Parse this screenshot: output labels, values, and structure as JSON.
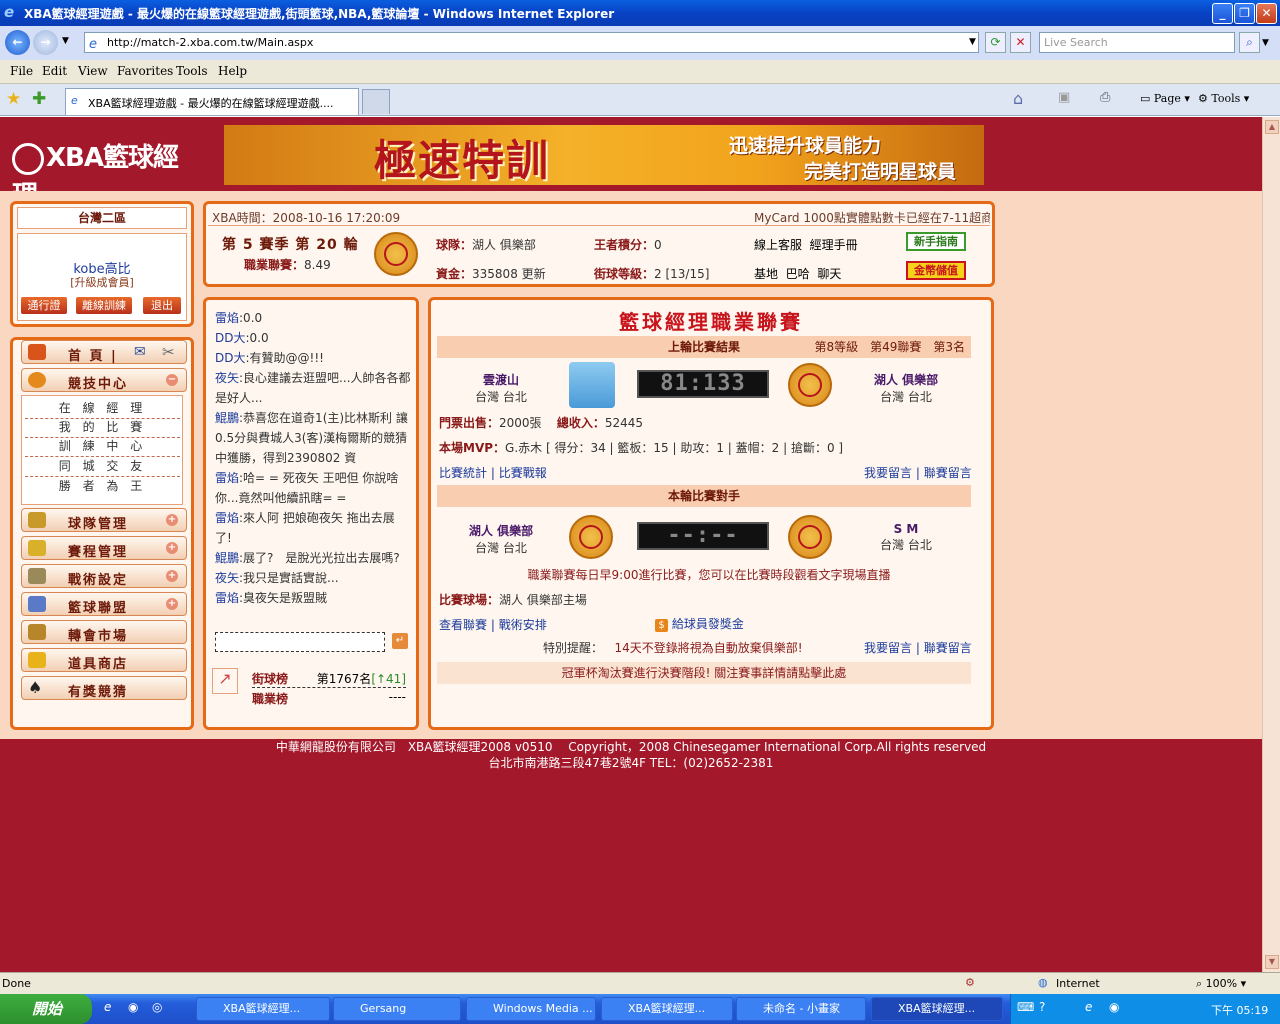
{
  "window": {
    "title": "XBA籃球經理遊戲 - 最火爆的在線籃球經理遊戲,街頭籃球,NBA,籃球論壇 - Windows Internet Explorer",
    "url": "http://match-2.xba.com.tw/Main.aspx",
    "search_placeholder": "Live Search",
    "menu": [
      "File",
      "Edit",
      "View",
      "Favorites",
      "Tools",
      "Help"
    ],
    "tab_title": "XBA籃球經理遊戲 - 最火爆的在線籃球經理遊戲....",
    "toolbar": {
      "page": "Page",
      "tools": "Tools"
    }
  },
  "header": {
    "logo": "XBA籃球經理",
    "banner_title": "極速特訓",
    "banner_line1": "迅速提升球員能力",
    "banner_line2": "完美打造明星球員"
  },
  "user": {
    "region": "台灣二區",
    "name": "kobe高比",
    "upgrade": "[升級成會員]",
    "buttons": [
      "通行證",
      "離線訓練",
      "退出"
    ]
  },
  "info": {
    "time_label": "XBA時間：",
    "time": "2008-10-16 17:20:09",
    "marquee": "MyCard 1000點實體點數卡已經在7-11超商",
    "season": "第 5 賽季 第 20 輪",
    "league_label": "職業聯賽：",
    "league_val": "8.49",
    "team_label": "球隊：",
    "team": "湖人 俱樂部",
    "king_label": "王者積分：",
    "king": "0",
    "service": "線上客服",
    "manual": "經理手冊",
    "newbie": "新手指南",
    "money_label": "資金：",
    "money": "335808",
    "update": "更新",
    "street_label": "街球等級：",
    "street": "2 [13/15]",
    "base": "基地",
    "bah": "巴哈",
    "chat": "聊天",
    "deposit": "金幣儲值"
  },
  "nav": {
    "home": "首 頁 |",
    "compete": "競技中心",
    "sub": [
      "在 線 經 理",
      "我 的 比 賽",
      "訓 練 中 心",
      "同 城 交 友",
      "勝 者 為 王"
    ],
    "items": [
      "球隊管理",
      "賽程管理",
      "戰術設定",
      "籃球聯盟",
      "轉會市場",
      "道具商店",
      "有獎競猜"
    ]
  },
  "chat": [
    {
      "n": "雷焰",
      "t": ":0.0"
    },
    {
      "n": "DD大",
      "t": ":0.0"
    },
    {
      "n": "DD大",
      "t": ":有贊助@@!!!"
    },
    {
      "n": "夜矢",
      "t": ":良心建議去逛盟吧...人帥各各都是好人..."
    },
    {
      "n": "鯤鵬",
      "t": ":恭喜您在道奇1(主)比林斯利 讓0.5分與費城人3(客)漢梅爾斯的競猜中獲勝，得到2390802 資"
    },
    {
      "n": "雷焰",
      "t": ":哈= = 死夜矢 王吧但 你說啥你...竟然叫他續訊瞎= ="
    },
    {
      "n": "雷焰",
      "t": ":來人阿 把娘砲夜矢 拖出去展了!"
    },
    {
      "n": "鯤鵬",
      "t": ":展了?　是脫光光拉出去展嗎?"
    },
    {
      "n": "夜矢",
      "t": ":我只是實話實說..."
    },
    {
      "n": "雷焰",
      "t": ":臭夜矢是叛盟賊"
    }
  ],
  "ranks": {
    "street_label": "街球榜",
    "street_val": "第1767名",
    "street_delta": "[↑41]",
    "pro_label": "職業榜",
    "pro_val": "----"
  },
  "league": {
    "title": "籃球經理職業聯賽",
    "last_header": "上輪比賽結果",
    "level_info": "第8等級　第49聯賽　第3名",
    "home_team": "雲渡山",
    "home_loc": "台灣 台北",
    "away_team": "湖人 俱樂部",
    "away_loc": "台灣 台北",
    "score": "81:133",
    "ticket_label": "門票出售：",
    "ticket": "2000張",
    "income_label": "總收入：",
    "income": "52445",
    "mvp_label": "本場MVP：",
    "mvp": "G.赤木 [ 得分：34 | 籃板：15 | 助攻：1 | 蓋帽：2 | 搶斷：0 ]",
    "stats_link": "比賽統計",
    "report_link": "比賽戰報",
    "msg_link": "我要留言",
    "league_msg_link": "聯賽留言",
    "next_header": "本輪比賽對手",
    "next_home": "湖人 俱樂部",
    "next_home_loc": "台灣 台北",
    "next_away": "S M",
    "next_away_loc": "台灣 台北",
    "next_score": "--:--",
    "schedule_note": "職業聯賽每日早9:00進行比賽，您可以在比賽時段觀看文字現場直播",
    "arena_label": "比賽球場：",
    "arena": "湖人 俱樂部主場",
    "view_league": "查看聯賽",
    "tactics": "戰術安排",
    "bonus": "給球員發獎金",
    "warn_label": "特別提醒：",
    "warn": "14天不登錄將視為自動放棄俱樂部!",
    "cup_note": "冠軍杯淘汰賽進行決賽階段! 關注賽事詳情請點擊此處"
  },
  "footer": {
    "line1": "中華網龍股份有限公司　XBA籃球經理2008 v0510　 Copyright，2008 Chinesegamer International Corp.All rights reserved",
    "line2": "台北市南港路三段47巷2號4F TEL：(02)2652-2381"
  },
  "status": {
    "done": "Done",
    "zone": "Internet",
    "zoom": "100%"
  },
  "taskbar": {
    "start": "開始",
    "tasks": [
      "XBA籃球經理...",
      "Gersang",
      "Windows Media ...",
      "XBA籃球經理...",
      "未命名 - 小畫家",
      "XBA籃球經理..."
    ],
    "clock": "下午 05:19"
  },
  "colors": {
    "page_bg": "#a3182a",
    "panel_border": "#e56a17",
    "accent": "#fad7c1"
  }
}
